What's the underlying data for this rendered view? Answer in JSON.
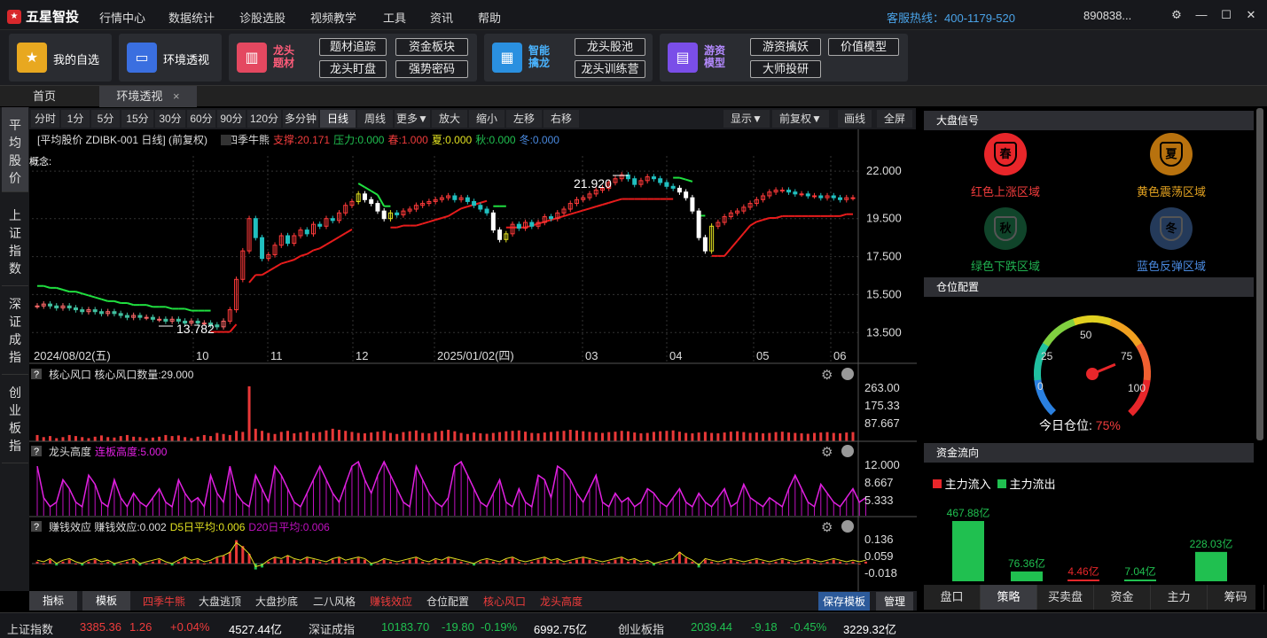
{
  "app": {
    "logo": "五星智投",
    "menu": [
      "行情中心",
      "数据统计",
      "诊股选股",
      "视频教学",
      "工具",
      "资讯",
      "帮助"
    ],
    "hotline": "客服热线：400-1179-520",
    "account": "890838..."
  },
  "toolbar": {
    "fav": "我的自选",
    "env": "环境透视",
    "g1": {
      "t1": "龙头",
      "t2": "题材",
      "b": [
        "题材追踪",
        "资金板块",
        "龙头盯盘",
        "强势密码"
      ]
    },
    "g2": {
      "t1": "智能",
      "t2": "擒龙",
      "b": [
        "龙头股池",
        "龙头训练营"
      ]
    },
    "g3": {
      "t1": "游资",
      "t2": "模型",
      "b": [
        "游资擒妖",
        "价值模型",
        "大师投研"
      ]
    }
  },
  "tabs": [
    "首页",
    "环境透视"
  ],
  "sidebar": [
    "平均股价",
    "上证指数",
    "深证成指",
    "创业板指"
  ],
  "periods": [
    "分时",
    "1分",
    "5分",
    "15分",
    "30分",
    "60分",
    "90分",
    "120分",
    "多分钟",
    "日线",
    "周线",
    "更多▼",
    "放大",
    "缩小",
    "左移",
    "右移",
    "显示▼",
    "前复权▼",
    "画线",
    "全屏"
  ],
  "info": {
    "title": "[平均股价 ZDIBK-001 日线]  (前复权)",
    "ind": "四季牛熊",
    "support": "支撑:20.171",
    "pressure": "压力:0.000",
    "spring": "春:1.000",
    "summer": "夏:0.000",
    "autumn": "秋:0.000",
    "winter": "冬:0.000",
    "concept": "概念:"
  },
  "price_axis": [
    "22.000",
    "19.500",
    "17.500",
    "15.500",
    "13.500"
  ],
  "date_axis": [
    "2024/08/02(五)",
    "10",
    "11",
    "12",
    "2025/01/02(四)",
    "03",
    "04",
    "05",
    "06"
  ],
  "annotations": {
    "high": "21.920",
    "low": "13.782"
  },
  "panel1": {
    "q": "?",
    "title": "核心风口  核心风口数量:29.000",
    "axis": [
      "263.00",
      "175.33",
      "87.667"
    ]
  },
  "panel2": {
    "q": "?",
    "title": "龙头高度",
    "sub": "连板高度:5.000",
    "axis": [
      "12.000",
      "8.667",
      "5.333"
    ]
  },
  "panel3": {
    "q": "?",
    "title": "赚钱效应  赚钱效应:0.002",
    "d5": "D5日平均:0.006",
    "d20": "D20日平均:0.006",
    "axis": [
      "0.136",
      "0.059",
      "-0.018"
    ]
  },
  "bottom_tabs": [
    "指标",
    "模板",
    "四季牛熊",
    "大盘逃顶",
    "大盘抄底",
    "二八风格",
    "赚钱效应",
    "仓位配置",
    "核心风口",
    "龙头高度"
  ],
  "bottom_right": [
    "保存模板",
    "管理"
  ],
  "right": {
    "sec1": "大盘信号",
    "seals": [
      {
        "ch": "春",
        "label": "红色上涨区域",
        "color": "#e8262a"
      },
      {
        "ch": "夏",
        "label": "黄色震荡区域",
        "color": "#b8720e"
      },
      {
        "ch": "秋",
        "label": "绿色下跌区域",
        "color": "#10442a"
      },
      {
        "ch": "冬",
        "label": "蓝色反弹区域",
        "color": "#243a5a"
      }
    ],
    "sec2": "仓位配置",
    "gauge": {
      "ticks": [
        "0",
        "25",
        "50",
        "75",
        "100"
      ],
      "label": "今日仓位:",
      "value": "75%",
      "pct": 75
    },
    "sec3": "资金流向",
    "legend": [
      "主力流入",
      "主力流出"
    ],
    "flows": [
      {
        "label": "467.88亿",
        "v": 467.88,
        "color": "#20c050",
        "lc": "#20c050"
      },
      {
        "label": "76.36亿",
        "v": 76.36,
        "color": "#20c050",
        "lc": "#20c050"
      },
      {
        "label": "4.46亿",
        "v": 4.46,
        "color": "#e8262a",
        "lc": "#e8262a"
      },
      {
        "label": "7.04亿",
        "v": 7.04,
        "color": "#20c050",
        "lc": "#20c050"
      },
      {
        "label": "228.03亿",
        "v": 228.03,
        "color": "#20c050",
        "lc": "#20c050"
      }
    ],
    "rtabs": [
      "盘口",
      "策略",
      "买卖盘",
      "资金",
      "主力",
      "筹码"
    ]
  },
  "status": [
    {
      "name": "上证指数",
      "v": "3385.36",
      "c": "1.26",
      "p": "+0.04%",
      "a": "4527.44亿",
      "col": "#f03c3c"
    },
    {
      "name": "深证成指",
      "v": "10183.70",
      "c": "-19.80",
      "p": "-0.19%",
      "a": "6992.75亿",
      "col": "#20c050"
    },
    {
      "name": "创业板指",
      "v": "2039.44",
      "c": "-9.18",
      "p": "-0.45%",
      "a": "3229.32亿",
      "col": "#20c050"
    }
  ],
  "chart_data": {
    "type": "candlestick",
    "title": "平均股价 ZDIBK-001 日线",
    "x_range": [
      "2024/08/02",
      "2025/06"
    ],
    "ylim": [
      13.0,
      22.8
    ],
    "high": 21.92,
    "low": 13.782,
    "close": [
      14.9,
      15.0,
      14.9,
      14.8,
      14.9,
      14.8,
      14.7,
      14.6,
      14.7,
      14.6,
      14.5,
      14.6,
      14.5,
      14.4,
      14.3,
      14.4,
      14.3,
      14.3,
      14.2,
      14.2,
      14.1,
      14.2,
      14.1,
      14.0,
      14.1,
      14.0,
      14.0,
      13.9,
      13.8,
      14.1,
      14.7,
      16.3,
      17.8,
      19.5,
      18.5,
      17.4,
      17.6,
      18.1,
      18.6,
      18.2,
      18.6,
      18.9,
      18.7,
      19.2,
      19.1,
      19.5,
      19.4,
      19.8,
      20.2,
      20.4,
      20.8,
      20.5,
      20.3,
      19.9,
      19.5,
      19.8,
      19.7,
      19.9,
      20.0,
      20.2,
      20.3,
      20.4,
      20.5,
      20.6,
      20.7,
      20.5,
      20.6,
      20.4,
      20.2,
      20.0,
      19.8,
      18.9,
      18.4,
      18.7,
      19.2,
      19.0,
      19.3,
      19.1,
      19.3,
      19.6,
      19.5,
      19.8,
      20.0,
      20.3,
      20.5,
      20.6,
      20.8,
      21.0,
      21.1,
      21.4,
      21.6,
      21.8,
      21.6,
      21.3,
      21.5,
      21.7,
      21.6,
      21.4,
      21.2,
      21.1,
      20.9,
      20.6,
      19.9,
      18.5,
      17.8,
      19.1,
      19.3,
      19.6,
      19.8,
      19.9,
      20.1,
      20.3,
      20.5,
      20.7,
      20.9,
      21.0,
      21.0,
      20.9,
      20.8,
      20.8,
      20.7,
      20.7,
      20.6,
      20.7,
      20.6,
      20.5,
      20.6,
      20.6
    ],
    "support": [
      15.3,
      15.3,
      15.2,
      15.2,
      15.1,
      15.0,
      15.0,
      14.9,
      14.8,
      14.7,
      14.6,
      14.5,
      14.5,
      14.4,
      14.4,
      14.3,
      14.3,
      14.3,
      14.2,
      14.2,
      14.2,
      14.1,
      14.1,
      14.1,
      14.0,
      14.0,
      14.0,
      14.0,
      14.0,
      14.0,
      14.0,
      14.4,
      15.3,
      16.6,
      17.0,
      17.0,
      17.2,
      17.4,
      17.6,
      17.7,
      17.8,
      18.0,
      18.1,
      18.3,
      18.4,
      18.6,
      18.8,
      19.0,
      19.2,
      19.4,
      20.7,
      20.5,
      20.3,
      20.1,
      19.5,
      19.5,
      19.5,
      19.6,
      19.6,
      19.6,
      19.7,
      19.8,
      19.9,
      20.0,
      20.1,
      20.3,
      20.5,
      20.6,
      20.7,
      20.8,
      20.9,
      19.5,
      19.5,
      19.5,
      19.5,
      19.5,
      19.5,
      19.6,
      19.7,
      19.8,
      19.9,
      20.0,
      20.1,
      20.2,
      20.3,
      20.4,
      20.5,
      20.6,
      20.7,
      20.8,
      20.9,
      21.0,
      21.0,
      21.0,
      21.0,
      21.0,
      21.0,
      21.0,
      21.0,
      21.0,
      21.0,
      20.9,
      20.8,
      19.0,
      19.0,
      18.0,
      18.0,
      18.0,
      18.4,
      18.8,
      19.2,
      19.6,
      19.8,
      19.9,
      20.0,
      20.0,
      20.1,
      20.1,
      20.1,
      20.1,
      20.1,
      20.1,
      20.1,
      20.1,
      20.1,
      20.1,
      20.2,
      20.2
    ],
    "panel1_values": [
      30,
      20,
      25,
      15,
      20,
      30,
      25,
      20,
      15,
      22,
      28,
      20,
      18,
      25,
      30,
      22,
      20,
      15,
      18,
      22,
      30,
      25,
      28,
      20,
      15,
      22,
      30,
      25,
      40,
      35,
      30,
      50,
      45,
      263,
      60,
      50,
      40,
      35,
      45,
      50,
      38,
      42,
      48,
      40,
      44,
      52,
      60,
      55,
      50,
      45,
      40,
      38,
      42,
      46,
      50,
      40,
      35,
      44,
      48,
      52,
      40,
      38,
      45,
      50,
      55,
      48,
      40,
      35,
      42,
      38,
      36,
      40,
      44,
      48,
      50,
      52,
      46,
      40,
      38,
      42,
      45,
      48,
      50,
      55,
      52,
      48,
      45,
      42,
      40,
      44,
      46,
      50,
      48,
      42,
      38,
      40,
      45,
      48,
      50,
      52,
      46,
      40,
      38,
      42,
      45,
      40,
      38,
      42,
      46,
      48,
      44,
      40,
      42,
      38,
      40,
      44,
      46,
      42,
      40,
      38,
      36,
      40,
      42,
      44,
      40,
      38,
      42,
      44
    ],
    "panel2_values": [
      11,
      4,
      2,
      3,
      8,
      6,
      3,
      2,
      9,
      7,
      3,
      2,
      8,
      4,
      2,
      5,
      3,
      2,
      4,
      6,
      3,
      2,
      8,
      5,
      3,
      4,
      2,
      9,
      5,
      3,
      11,
      5,
      3,
      2,
      9,
      6,
      3,
      11,
      9,
      6,
      3,
      2,
      5,
      8,
      11,
      8,
      5,
      3,
      7,
      11,
      12,
      8,
      5,
      9,
      12,
      9,
      6,
      3,
      2,
      11,
      8,
      5,
      3,
      2,
      4,
      11,
      12,
      9,
      6,
      3,
      2,
      5,
      8,
      3,
      2,
      6,
      3,
      2,
      9,
      8,
      4,
      11,
      10,
      8,
      5,
      3,
      6,
      9,
      3,
      2,
      5,
      3,
      4,
      2,
      3,
      6,
      5,
      3,
      2,
      4,
      6,
      3,
      2,
      5,
      3,
      2,
      4,
      6,
      2,
      3,
      7,
      4,
      3,
      2,
      4,
      3,
      2,
      6,
      9,
      6,
      3,
      2,
      7,
      5,
      3,
      2,
      4,
      6,
      3,
      4
    ],
    "panel3_values": [
      0.01,
      0.0,
      0.02,
      -0.01,
      0.01,
      0.02,
      0.0,
      -0.01,
      0.01,
      0.02,
      0.0,
      0.01,
      -0.01,
      0.0,
      0.01,
      0.02,
      -0.01,
      0.0,
      0.01,
      0.02,
      0.0,
      -0.01,
      0.01,
      0.03,
      0.01,
      0.02,
      0.0,
      0.01,
      0.03,
      0.04,
      0.06,
      0.12,
      0.09,
      0.05,
      -0.03,
      -0.02,
      0.01,
      0.03,
      0.02,
      0.04,
      0.02,
      0.01,
      0.03,
      0.02,
      0.01,
      0.0,
      0.02,
      0.03,
      0.01,
      0.02,
      0.03,
      0.02,
      -0.01,
      0.0,
      0.02,
      0.01,
      0.0,
      0.01,
      0.02,
      0.03,
      0.01,
      0.0,
      0.02,
      0.01,
      0.03,
      0.02,
      0.01,
      0.0,
      -0.01,
      0.01,
      0.02,
      0.01,
      0.0,
      0.02,
      0.03,
      0.01,
      0.0,
      0.01,
      0.02,
      0.03,
      0.01,
      0.02,
      0.0,
      0.01,
      0.02,
      0.03,
      0.02,
      0.01,
      0.0,
      0.01,
      0.02,
      0.03,
      0.01,
      0.02,
      0.0,
      0.01,
      -0.01,
      0.0,
      0.01,
      0.02,
      0.06,
      0.03,
      0.01,
      -0.02,
      0.02,
      0.01,
      0.0,
      0.01,
      0.02,
      0.01,
      0.0,
      0.01,
      0.02,
      0.01,
      0.0,
      0.01,
      0.02,
      0.01,
      0.0,
      0.01,
      0.02,
      0.01,
      0.0,
      0.01,
      0.02,
      0.01,
      0.0,
      0.01,
      0.0,
      0.01
    ]
  }
}
